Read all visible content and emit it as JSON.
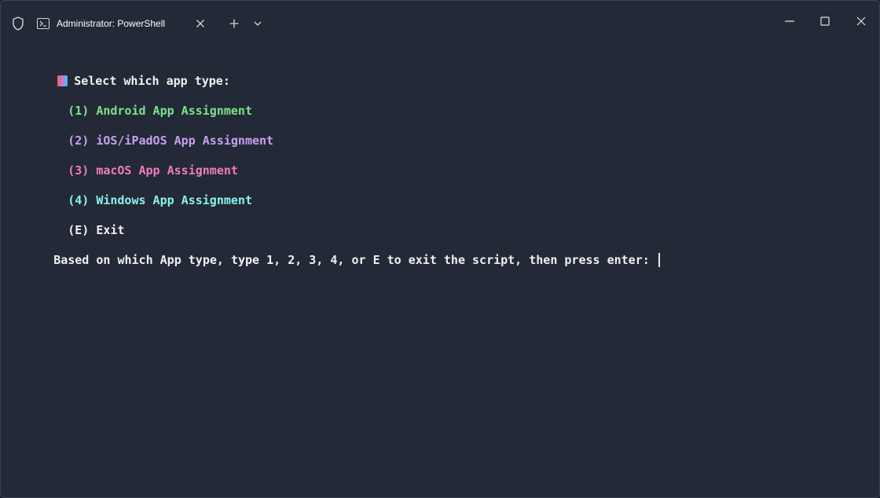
{
  "window": {
    "tab_title": "Administrator: PowerShell"
  },
  "icons": {
    "shield": "shield-icon",
    "powershell": "powershell-icon",
    "close_tab": "close-icon",
    "new_tab": "plus-icon",
    "dropdown": "chevron-down-icon",
    "minimize": "minimize-icon",
    "maximize": "maximize-icon",
    "close_window": "close-icon"
  },
  "terminal": {
    "heading": "Select which app type:",
    "options": [
      {
        "key": "(1)",
        "label": "Android App Assignment",
        "color": "#7be38c"
      },
      {
        "key": "(2)",
        "label": "iOS/iPadOS App Assignment",
        "color": "#c8a0f0"
      },
      {
        "key": "(3)",
        "label": "macOS App Assignment",
        "color": "#f07cc0"
      },
      {
        "key": "(4)",
        "label": "Windows App Assignment",
        "color": "#8ef0f0"
      },
      {
        "key": "(E)",
        "label": "Exit",
        "color": "#f0f0f0"
      }
    ],
    "prompt": "Based on which App type, type 1, 2, 3, 4, or E to exit the script, then press enter: "
  }
}
